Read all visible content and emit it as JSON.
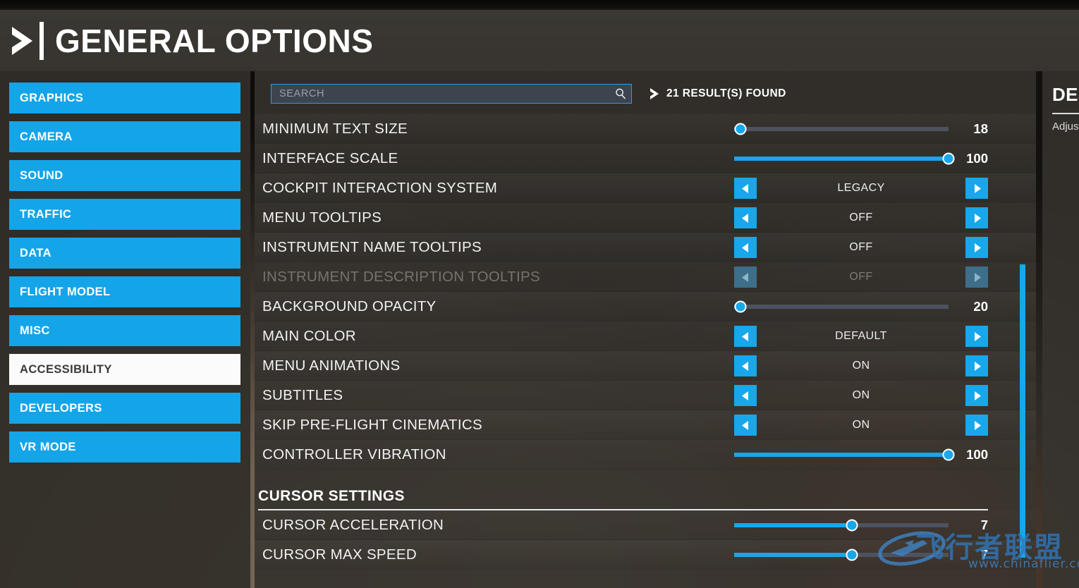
{
  "header": {
    "title": "GENERAL OPTIONS",
    "arrow_icon": "chevron-right-icon"
  },
  "sidebar": {
    "items": [
      {
        "label": "GRAPHICS",
        "selected": false
      },
      {
        "label": "CAMERA",
        "selected": false
      },
      {
        "label": "SOUND",
        "selected": false
      },
      {
        "label": "TRAFFIC",
        "selected": false
      },
      {
        "label": "DATA",
        "selected": false
      },
      {
        "label": "FLIGHT MODEL",
        "selected": false
      },
      {
        "label": "MISC",
        "selected": false
      },
      {
        "label": "ACCESSIBILITY",
        "selected": true
      },
      {
        "label": "DEVELOPERS",
        "selected": false
      },
      {
        "label": "VR MODE",
        "selected": false
      }
    ]
  },
  "search": {
    "value": "",
    "placeholder": "SEARCH",
    "icon": "search-icon",
    "results_text": "21 RESULT(S) FOUND",
    "results_icon": "chevron-right-icon"
  },
  "settings": [
    {
      "kind": "slider",
      "label": "MINIMUM TEXT SIZE",
      "value": "18",
      "percent": 3,
      "disabled": false
    },
    {
      "kind": "slider",
      "label": "INTERFACE SCALE",
      "value": "100",
      "percent": 100,
      "disabled": false
    },
    {
      "kind": "spinner",
      "label": "COCKPIT INTERACTION SYSTEM",
      "value": "LEGACY",
      "disabled": false
    },
    {
      "kind": "spinner",
      "label": "MENU TOOLTIPS",
      "value": "OFF",
      "disabled": false
    },
    {
      "kind": "spinner",
      "label": "INSTRUMENT NAME TOOLTIPS",
      "value": "OFF",
      "disabled": false
    },
    {
      "kind": "spinner",
      "label": "INSTRUMENT DESCRIPTION TOOLTIPS",
      "value": "OFF",
      "disabled": true
    },
    {
      "kind": "slider",
      "label": "BACKGROUND OPACITY",
      "value": "20",
      "percent": 3,
      "disabled": false
    },
    {
      "kind": "spinner",
      "label": "MAIN COLOR",
      "value": "DEFAULT",
      "disabled": false
    },
    {
      "kind": "spinner",
      "label": "MENU ANIMATIONS",
      "value": "ON",
      "disabled": false
    },
    {
      "kind": "spinner",
      "label": "SUBTITLES",
      "value": "ON",
      "disabled": false
    },
    {
      "kind": "spinner",
      "label": "SKIP PRE-FLIGHT CINEMATICS",
      "value": "ON",
      "disabled": false
    },
    {
      "kind": "slider",
      "label": "CONTROLLER VIBRATION",
      "value": "100",
      "percent": 100,
      "disabled": false
    },
    {
      "kind": "section",
      "label": "CURSOR SETTINGS"
    },
    {
      "kind": "slider",
      "label": "CURSOR ACCELERATION",
      "value": "7",
      "percent": 55,
      "disabled": false
    },
    {
      "kind": "slider",
      "label": "CURSOR MAX SPEED",
      "value": "7",
      "percent": 55,
      "disabled": false
    }
  ],
  "description_panel": {
    "title": "DESCRIPTION",
    "body": "Adjusts the"
  },
  "watermark": {
    "text": "飞行者联盟",
    "url": "www.chinaflier.com"
  },
  "colors": {
    "accent": "#17a7ea",
    "nav": "#14a4e8",
    "nav_selected_bg": "#fbfbfb",
    "panel": "#34312c",
    "header": "#3b3833"
  }
}
